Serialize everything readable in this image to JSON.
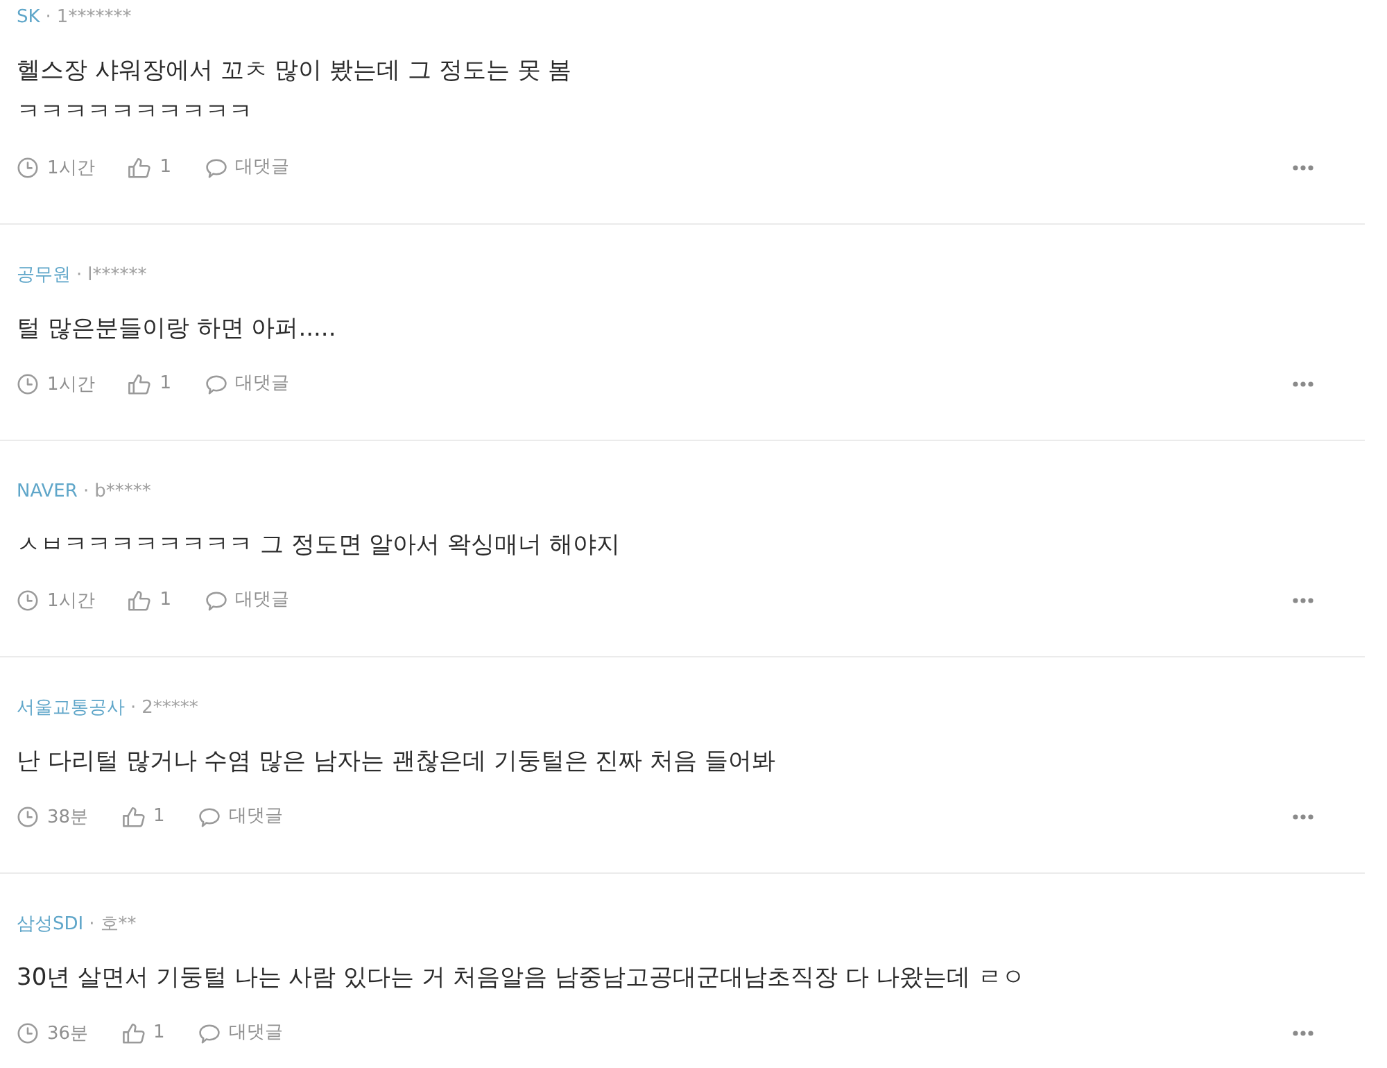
{
  "comments": [
    {
      "source": "SK",
      "separator": "·",
      "author": "1*******",
      "text": "헬스장 샤워장에서 꼬ㅊ 많이 봤는데 그 정도는 못 봄\nㅋㅋㅋㅋㅋㅋㅋㅋㅋㅋ",
      "time": "1시간",
      "likes": "1",
      "reply_label": "대댓글"
    },
    {
      "source": "공무원",
      "separator": "·",
      "author": "l******",
      "text": "털 많은분들이랑 하면 아퍼.....",
      "time": "1시간",
      "likes": "1",
      "reply_label": "대댓글"
    },
    {
      "source": "NAVER",
      "separator": "·",
      "author": "b*****",
      "text": "ㅅㅂㅋㅋㅋㅋㅋㅋㅋㅋ 그 정도면 알아서 왁싱매너 해야지",
      "time": "1시간",
      "likes": "1",
      "reply_label": "대댓글"
    },
    {
      "source": "서울교통공사",
      "separator": "·",
      "author": "2*****",
      "text": "난 다리털 많거나 수염 많은 남자는 괜찮은데 기둥털은 진짜 처음 들어봐",
      "time": "38분",
      "likes": "1",
      "reply_label": "대댓글"
    },
    {
      "source": "삼성SDI",
      "separator": "·",
      "author": "호**",
      "text": "30년 살면서 기둥털 나는 사람 있다는 거 처음알음 남중남고공대군대남초직장 다 나왔는데 ㄹㅇ",
      "time": "36분",
      "likes": "1",
      "reply_label": "대댓글"
    }
  ]
}
